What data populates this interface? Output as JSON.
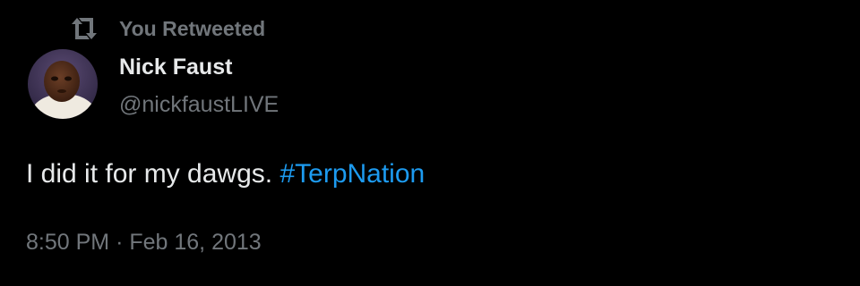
{
  "retweet": {
    "icon": "retweet-icon",
    "label": "You Retweeted"
  },
  "author": {
    "avatar_icon": "avatar-photo",
    "display_name": "Nick Faust",
    "handle": "@nickfaustLIVE"
  },
  "tweet": {
    "text": "I did it for my dawgs.",
    "hashtag": "#TerpNation"
  },
  "meta": {
    "time": "8:50 PM",
    "separator": "·",
    "date": "Feb 16, 2013"
  },
  "colors": {
    "background": "#000000",
    "text_primary": "#e7e9ea",
    "text_secondary": "#71767b",
    "accent": "#1d9bf0"
  }
}
